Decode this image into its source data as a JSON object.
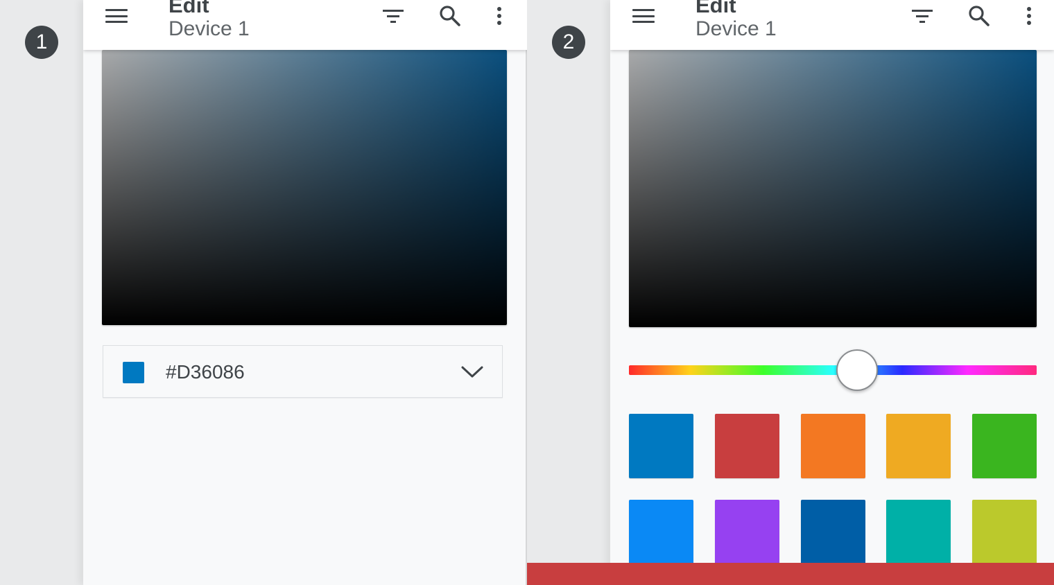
{
  "steps": {
    "left": "1",
    "right": "2"
  },
  "appbar": {
    "title": "Edit",
    "subtitle": "Device 1",
    "icon_menu": "menu-icon",
    "icon_filter": "filter-icon",
    "icon_search": "search-icon",
    "icon_more": "more-vert-icon"
  },
  "color_field": {
    "value": "#D36086",
    "swatch_color": "#0079c1",
    "icon": "chevron-down-icon"
  },
  "hue_slider": {
    "value_fraction": 0.56
  },
  "swatches": [
    "#0079c1",
    "#c83e3f",
    "#f37822",
    "#efaa22",
    "#3ab51f",
    "#0a89f5",
    "#9641f1",
    "#005ea6",
    "#00b0a7",
    "#bbc92c"
  ],
  "colors": {
    "bottom_bar": "#c83e3f",
    "dark": "#3f4448"
  }
}
